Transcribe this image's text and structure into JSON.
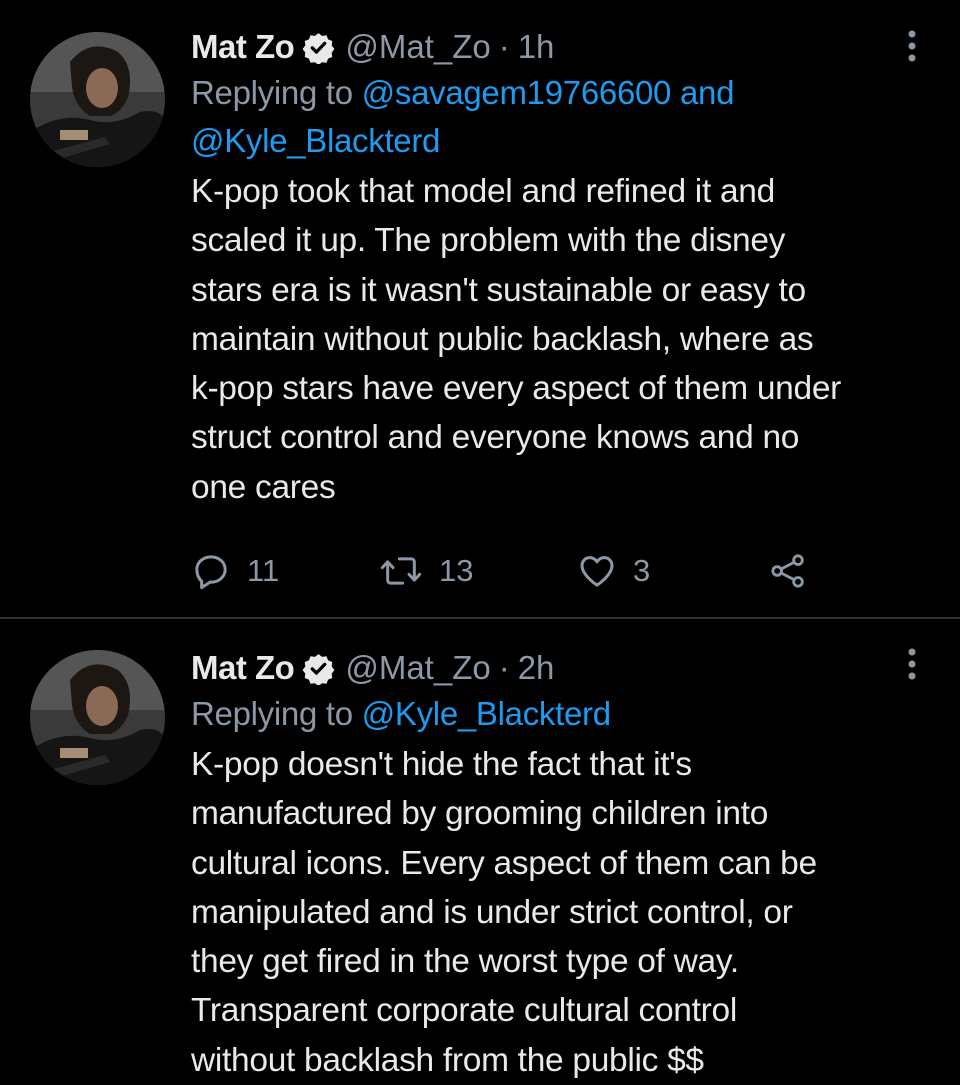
{
  "colors": {
    "background": "#000000",
    "text_primary": "#e7e9ea",
    "text_secondary": "#8b98a5",
    "link": "#1d9bf0",
    "divider": "#2f3336"
  },
  "tweets": [
    {
      "author_name": "Mat Zo",
      "handle": "@Mat_Zo",
      "separator": "·",
      "time": "1h",
      "verified_icon": "verified-badge-icon",
      "replying_prefix": "Replying to ",
      "mention_1": "@savagem19766600",
      "replying_joiner": " and",
      "mention_2": "@Kyle_Blackterd",
      "lines": [
        "K-pop took that model and refined it and",
        "scaled it up. The problem with the disney",
        "stars era is it wasn't sustainable or easy to",
        "maintain without public backlash, where as",
        "k-pop stars have every aspect of them under",
        "struct control and everyone knows and no",
        "one cares"
      ],
      "reply_count": "11",
      "retweet_count": "13",
      "like_count": "3"
    },
    {
      "author_name": "Mat Zo",
      "handle": "@Mat_Zo",
      "separator": "·",
      "time": "2h",
      "verified_icon": "verified-badge-icon",
      "replying_prefix": "Replying to ",
      "mention_1": "@Kyle_Blackterd",
      "lines": [
        "K-pop doesn't hide the fact that it's",
        "manufactured by grooming children into",
        "cultural icons. Every aspect of them can be",
        "manipulated and is under strict control, or",
        "they get fired in the worst type of way.",
        "Transparent corporate cultural control",
        "without backlash from the public $$"
      ]
    }
  ]
}
